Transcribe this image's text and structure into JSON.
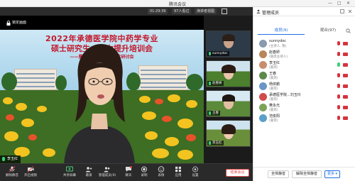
{
  "window": {
    "title": "腾讯会议",
    "controls": [
      "—",
      "□",
      "✕"
    ]
  },
  "status_bar": {
    "time": "01:29:39",
    "viewer_count": "97人看过",
    "speaker_view": "演讲者视图"
  },
  "stage": {
    "lock_label": "锁定画面",
    "banner_line1": "2022年承德医学院中药学专业",
    "banner_line2": "硕士研究生……力提升培训会",
    "banner_line3": "——暨河北省……检查学术研讨会",
    "speaker_name": "李玉红"
  },
  "gallery": [
    {
      "name": "sunnydoc",
      "bg": "#2d3a48"
    },
    {
      "name": "赵春妍",
      "bg": "#4c7f2e"
    },
    {
      "name": "王春",
      "bg": "#5b8a3a"
    },
    {
      "name": "李玉红",
      "bg": "#6a8f3b"
    }
  ],
  "panel": {
    "title": "管理成员",
    "tab_joined": "成员(9)",
    "tab_not_joined": "观众(97)",
    "participants": [
      {
        "name": "sunnydoc",
        "role": "(主持人, 我)",
        "color": "#8a9bb0",
        "mic_on": false
      },
      {
        "name": "赵春妍",
        "role": "(联席主持人)",
        "color": "#b9865a",
        "mic_on": false
      },
      {
        "name": "李玉红",
        "role": "(嘉宾)",
        "color": "#c98e6e",
        "mic_on": true
      },
      {
        "name": "王春",
        "role": "(嘉宾)",
        "color": "#5d8a4a",
        "mic_on": false
      },
      {
        "name": "杨依鹏",
        "role": "(嘉宾)",
        "color": "#6b95c8",
        "mic_on": false
      },
      {
        "name": "承德医学院...刘玉玲",
        "role": "(嘉宾)",
        "color": "#d14b4b",
        "mic_on": false
      },
      {
        "name": "樊永光",
        "role": "(嘉宾)",
        "color": "#7da35a",
        "mic_on": false
      },
      {
        "name": "范俊阳",
        "role": "(嘉宾)",
        "color": "#5aa0c8",
        "mic_on": false
      }
    ],
    "btn_mute_all": "全体静音",
    "btn_unmute_all": "解除全体静音",
    "btn_more": "更多"
  },
  "toolbar": {
    "items": [
      {
        "label": "解除静音",
        "icon": "mic-muted-icon"
      },
      {
        "label": "开启视频",
        "icon": "camera-off-icon"
      },
      {
        "label": "共享屏幕",
        "icon": "share-screen-icon"
      },
      {
        "label": "邀请",
        "icon": "invite-icon"
      },
      {
        "label": "管理成员(9)",
        "icon": "members-icon"
      },
      {
        "label": "聊天",
        "icon": "chat-icon"
      },
      {
        "label": "录制",
        "icon": "record-icon"
      },
      {
        "label": "表情",
        "icon": "emoji-icon"
      },
      {
        "label": "应用",
        "icon": "apps-icon"
      },
      {
        "label": "设置",
        "icon": "settings-icon"
      }
    ],
    "end_label": "结束会议"
  }
}
